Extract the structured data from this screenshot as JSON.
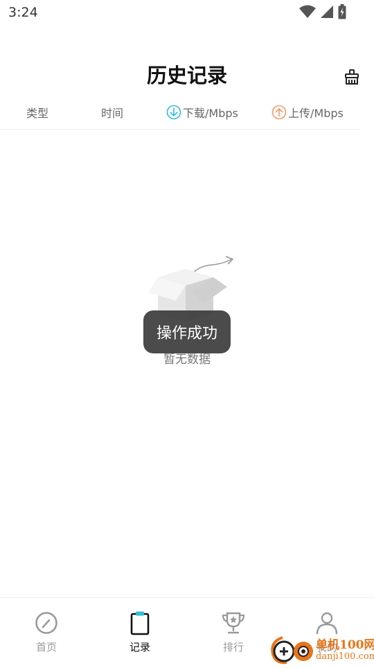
{
  "status_bar": {
    "time": "3:24"
  },
  "header": {
    "title": "历史记录",
    "clean_icon": "broom-icon"
  },
  "columns": {
    "type": "类型",
    "time": "时间",
    "download": "下载/Mbps",
    "upload": "上传/Mbps",
    "download_color": "#2bbfdc",
    "upload_color": "#f09a6a"
  },
  "empty": {
    "text": "暂无数据"
  },
  "toast": {
    "text": "操作成功"
  },
  "nav": {
    "items": [
      {
        "label": "首页",
        "icon": "speedometer-icon"
      },
      {
        "label": "记录",
        "icon": "clipboard-icon",
        "active": true
      },
      {
        "label": "排行",
        "icon": "trophy-icon"
      },
      {
        "label": "我的",
        "icon": "person-icon"
      }
    ]
  },
  "watermark": {
    "name": "单机100网",
    "url": "danji100.com"
  }
}
